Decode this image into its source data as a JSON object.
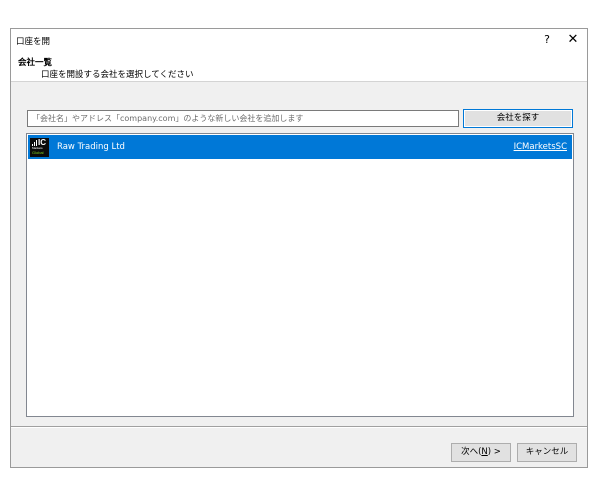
{
  "window": {
    "title": "口座を開",
    "help_glyph": "?",
    "close_glyph": "✕"
  },
  "header": {
    "heading": "会社一覧",
    "subheading": "口座を開設する会社を選択してください"
  },
  "search": {
    "placeholder": "「会社名」やアドレス「company.com」のような新しい会社を追加します",
    "value": "",
    "button_label": "会社を探す"
  },
  "companies": [
    {
      "name": "Raw Trading Ltd",
      "server": "ICMarketsSC",
      "selected": true,
      "logo": {
        "brand": "IC",
        "line1": "Markets",
        "line2": "Global",
        "accent": "#7ed321"
      }
    }
  ],
  "footer": {
    "next_prefix": "次へ(",
    "next_mnemonic": "N",
    "next_suffix": ") >",
    "cancel_label": "キャンセル"
  },
  "colors": {
    "selection": "#0078d7",
    "window_bg": "#f0f0f0",
    "button_face": "#e1e1e1",
    "logo_bg": "#0b0b0b"
  }
}
